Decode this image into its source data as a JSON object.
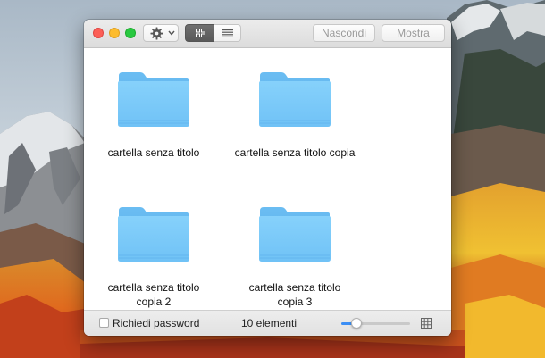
{
  "window": {
    "traffic_lights": [
      "close",
      "minimize",
      "maximize"
    ]
  },
  "toolbar": {
    "action_icon": "gear-icon",
    "view_modes": [
      {
        "icon": "icon-view-icon",
        "selected": true
      },
      {
        "icon": "list-view-icon",
        "selected": false
      }
    ],
    "hide_label": "Nascondi",
    "show_label": "Mostra"
  },
  "items": [
    {
      "icon": "folder-icon",
      "name": "cartella senza titolo"
    },
    {
      "icon": "folder-icon",
      "name": "cartella senza titolo copia"
    },
    {
      "icon": "folder-icon",
      "name": "cartella senza titolo copia 2"
    },
    {
      "icon": "folder-icon",
      "name": "cartella senza titolo copia 3"
    }
  ],
  "statusbar": {
    "password_checkbox_label": "Richiedi password",
    "password_checked": false,
    "item_count": "10 elementi",
    "icon_size_fraction": 0.22
  },
  "colors": {
    "folder": "#7ccaf7",
    "accent": "#3b8ef5"
  }
}
